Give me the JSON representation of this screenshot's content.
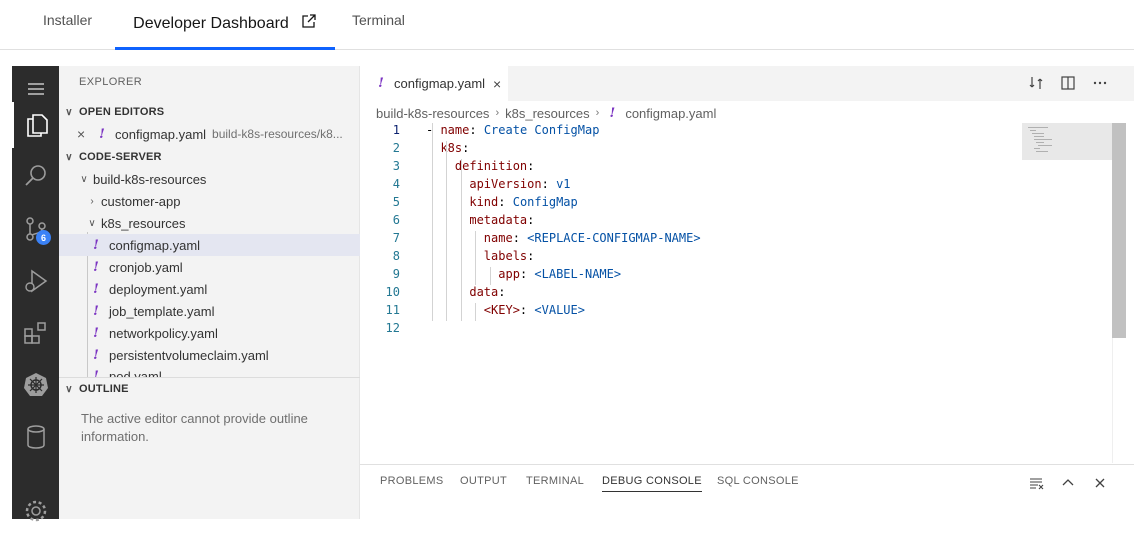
{
  "top_tabs": [
    {
      "label": "Installer"
    },
    {
      "label": "Developer Dashboard",
      "active": true
    },
    {
      "label": "Terminal"
    }
  ],
  "activity_bar": {
    "items": [
      "menu-icon",
      "files-icon",
      "search-icon",
      "source-control-icon",
      "run-debug-icon",
      "extensions-icon",
      "kubernetes-icon",
      "database-icon",
      "settings-gear-icon"
    ],
    "source_control_badge": "6"
  },
  "sidebar": {
    "title": "EXPLORER",
    "open_editors": {
      "heading": "OPEN EDITORS",
      "items": [
        {
          "name": "configmap.yaml",
          "path": "build-k8s-resources/k8..."
        }
      ]
    },
    "workspace": {
      "heading": "CODE-SERVER",
      "folder": "build-k8s-resources",
      "subfolders": [
        "customer-app",
        "k8s_resources"
      ],
      "files": [
        "configmap.yaml",
        "cronjob.yaml",
        "deployment.yaml",
        "job_template.yaml",
        "networkpolicy.yaml",
        "persistentvolumeclaim.yaml",
        "pod.yaml"
      ]
    },
    "outline": {
      "heading": "OUTLINE",
      "message": "The active editor cannot provide outline information."
    }
  },
  "editor": {
    "tab": {
      "label": "configmap.yaml"
    },
    "breadcrumbs": [
      "build-k8s-resources",
      "k8s_resources",
      "configmap.yaml"
    ],
    "line_numbers": [
      "1",
      "2",
      "3",
      "4",
      "5",
      "6",
      "7",
      "8",
      "9",
      "10",
      "11",
      "12"
    ],
    "lines": [
      {
        "indent": "",
        "prefix": "- ",
        "key": "name",
        "value": "Create ConfigMap"
      },
      {
        "indent": "  ",
        "prefix": "",
        "key": "k8s",
        "value": ""
      },
      {
        "indent": "    ",
        "prefix": "",
        "key": "definition",
        "value": ""
      },
      {
        "indent": "      ",
        "prefix": "",
        "key": "apiVersion",
        "value": "v1"
      },
      {
        "indent": "      ",
        "prefix": "",
        "key": "kind",
        "value": "ConfigMap"
      },
      {
        "indent": "      ",
        "prefix": "",
        "key": "metadata",
        "value": ""
      },
      {
        "indent": "        ",
        "prefix": "",
        "key": "name",
        "value": "<REPLACE-CONFIGMAP-NAME>"
      },
      {
        "indent": "        ",
        "prefix": "",
        "key": "labels",
        "value": ""
      },
      {
        "indent": "          ",
        "prefix": "",
        "key": "app",
        "value": "<LABEL-NAME>"
      },
      {
        "indent": "      ",
        "prefix": "",
        "key": "data",
        "value": ""
      },
      {
        "indent": "        ",
        "prefix": "",
        "key": "<KEY>",
        "value": "<VALUE>"
      },
      {
        "indent": "",
        "prefix": "",
        "key": "",
        "value": ""
      }
    ]
  },
  "panel": {
    "tabs": [
      {
        "label": "PROBLEMS"
      },
      {
        "label": "OUTPUT"
      },
      {
        "label": "TERMINAL"
      },
      {
        "label": "DEBUG CONSOLE",
        "active": true
      },
      {
        "label": "SQL CONSOLE"
      }
    ]
  },
  "colors": {
    "accent_blue": "#0f62fe",
    "activity_bar": "#2c2c2c",
    "yaml_key": "#800000",
    "yaml_value": "#0451a5",
    "badge": "#3b82f6"
  }
}
